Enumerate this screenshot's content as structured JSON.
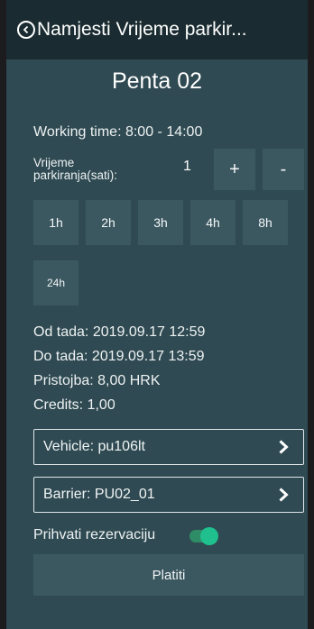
{
  "header": {
    "title": "Namjesti Vrijeme parkir..."
  },
  "station": {
    "name": "Penta 02"
  },
  "info": {
    "working_time": "Working time: 8:00 - 14:00",
    "duration_label": "Vrijeme parkiranja(sati):",
    "duration_value": "1",
    "plus_label": "+",
    "minus_label": "-"
  },
  "presets": [
    "1h",
    "2h",
    "3h",
    "4h",
    "8h",
    "24h"
  ],
  "details": {
    "from": "Od tada: 2019.09.17 12:59",
    "to": "Do tada: 2019.09.17 13:59",
    "fee": "Pristojba: 8,00  HRK",
    "credits": "Credits: 1,00"
  },
  "selectors": {
    "vehicle": "Vehicle: pu106lt",
    "barrier": "Barrier: PU02_01"
  },
  "reservation": {
    "label": "Prihvati rezervaciju",
    "accepted": true
  },
  "pay_button": {
    "label": "Platiti"
  },
  "colors": {
    "background": "#2f4a52",
    "header": "#1a2c31",
    "tile": "#3b5860",
    "toggle_on": "#20c08e"
  }
}
